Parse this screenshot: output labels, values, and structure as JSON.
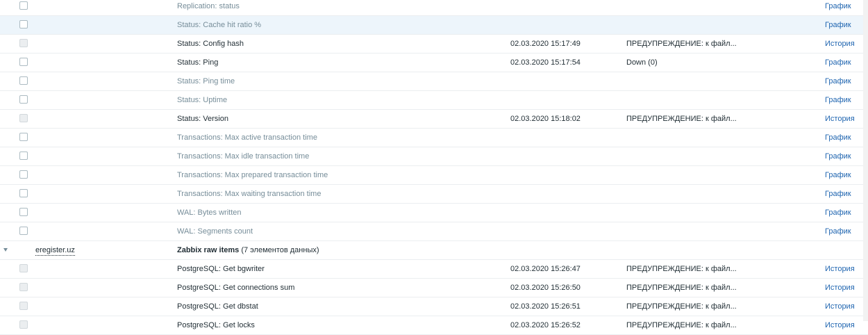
{
  "rows": [
    {
      "type": "item",
      "name": "Replication: status",
      "time": "",
      "info": "",
      "link": "График",
      "enabled": true,
      "muted": true
    },
    {
      "type": "item",
      "name": "Status: Cache hit ratio %",
      "time": "",
      "info": "",
      "link": "График",
      "enabled": true,
      "muted": true,
      "highlight": true
    },
    {
      "type": "item",
      "name": "Status: Config hash",
      "time": "02.03.2020 15:17:49",
      "info": "ПРЕДУПРЕЖДЕНИЕ: к файл...",
      "link": "История",
      "enabled": false,
      "muted": false
    },
    {
      "type": "item",
      "name": "Status: Ping",
      "time": "02.03.2020 15:17:54",
      "info": "Down (0)",
      "link": "График",
      "enabled": true,
      "muted": false
    },
    {
      "type": "item",
      "name": "Status: Ping time",
      "time": "",
      "info": "",
      "link": "График",
      "enabled": true,
      "muted": true
    },
    {
      "type": "item",
      "name": "Status: Uptime",
      "time": "",
      "info": "",
      "link": "График",
      "enabled": true,
      "muted": true
    },
    {
      "type": "item",
      "name": "Status: Version",
      "time": "02.03.2020 15:18:02",
      "info": "ПРЕДУПРЕЖДЕНИЕ: к файл...",
      "link": "История",
      "enabled": false,
      "muted": false
    },
    {
      "type": "item",
      "name": "Transactions: Max active transaction time",
      "time": "",
      "info": "",
      "link": "График",
      "enabled": true,
      "muted": true
    },
    {
      "type": "item",
      "name": "Transactions: Max idle transaction time",
      "time": "",
      "info": "",
      "link": "График",
      "enabled": true,
      "muted": true
    },
    {
      "type": "item",
      "name": "Transactions: Max prepared transaction time",
      "time": "",
      "info": "",
      "link": "График",
      "enabled": true,
      "muted": true
    },
    {
      "type": "item",
      "name": "Transactions: Max waiting transaction time",
      "time": "",
      "info": "",
      "link": "График",
      "enabled": true,
      "muted": true
    },
    {
      "type": "item",
      "name": "WAL: Bytes written",
      "time": "",
      "info": "",
      "link": "График",
      "enabled": true,
      "muted": true
    },
    {
      "type": "item",
      "name": "WAL: Segments count",
      "time": "",
      "info": "",
      "link": "График",
      "enabled": true,
      "muted": true
    },
    {
      "type": "group",
      "host": "eregister.uz",
      "app": "Zabbix raw items",
      "count": "(7 элементов данных)"
    },
    {
      "type": "item",
      "name": "PostgreSQL: Get bgwriter",
      "time": "02.03.2020 15:26:47",
      "info": "ПРЕДУПРЕЖДЕНИЕ: к файл...",
      "link": "История",
      "enabled": false,
      "muted": false
    },
    {
      "type": "item",
      "name": "PostgreSQL: Get connections sum",
      "time": "02.03.2020 15:26:50",
      "info": "ПРЕДУПРЕЖДЕНИЕ: к файл...",
      "link": "История",
      "enabled": false,
      "muted": false
    },
    {
      "type": "item",
      "name": "PostgreSQL: Get dbstat",
      "time": "02.03.2020 15:26:51",
      "info": "ПРЕДУПРЕЖДЕНИЕ: к файл...",
      "link": "История",
      "enabled": false,
      "muted": false
    },
    {
      "type": "item",
      "name": "PostgreSQL: Get locks",
      "time": "02.03.2020 15:26:52",
      "info": "ПРЕДУПРЕЖДЕНИЕ: к файл...",
      "link": "История",
      "enabled": false,
      "muted": false
    }
  ]
}
